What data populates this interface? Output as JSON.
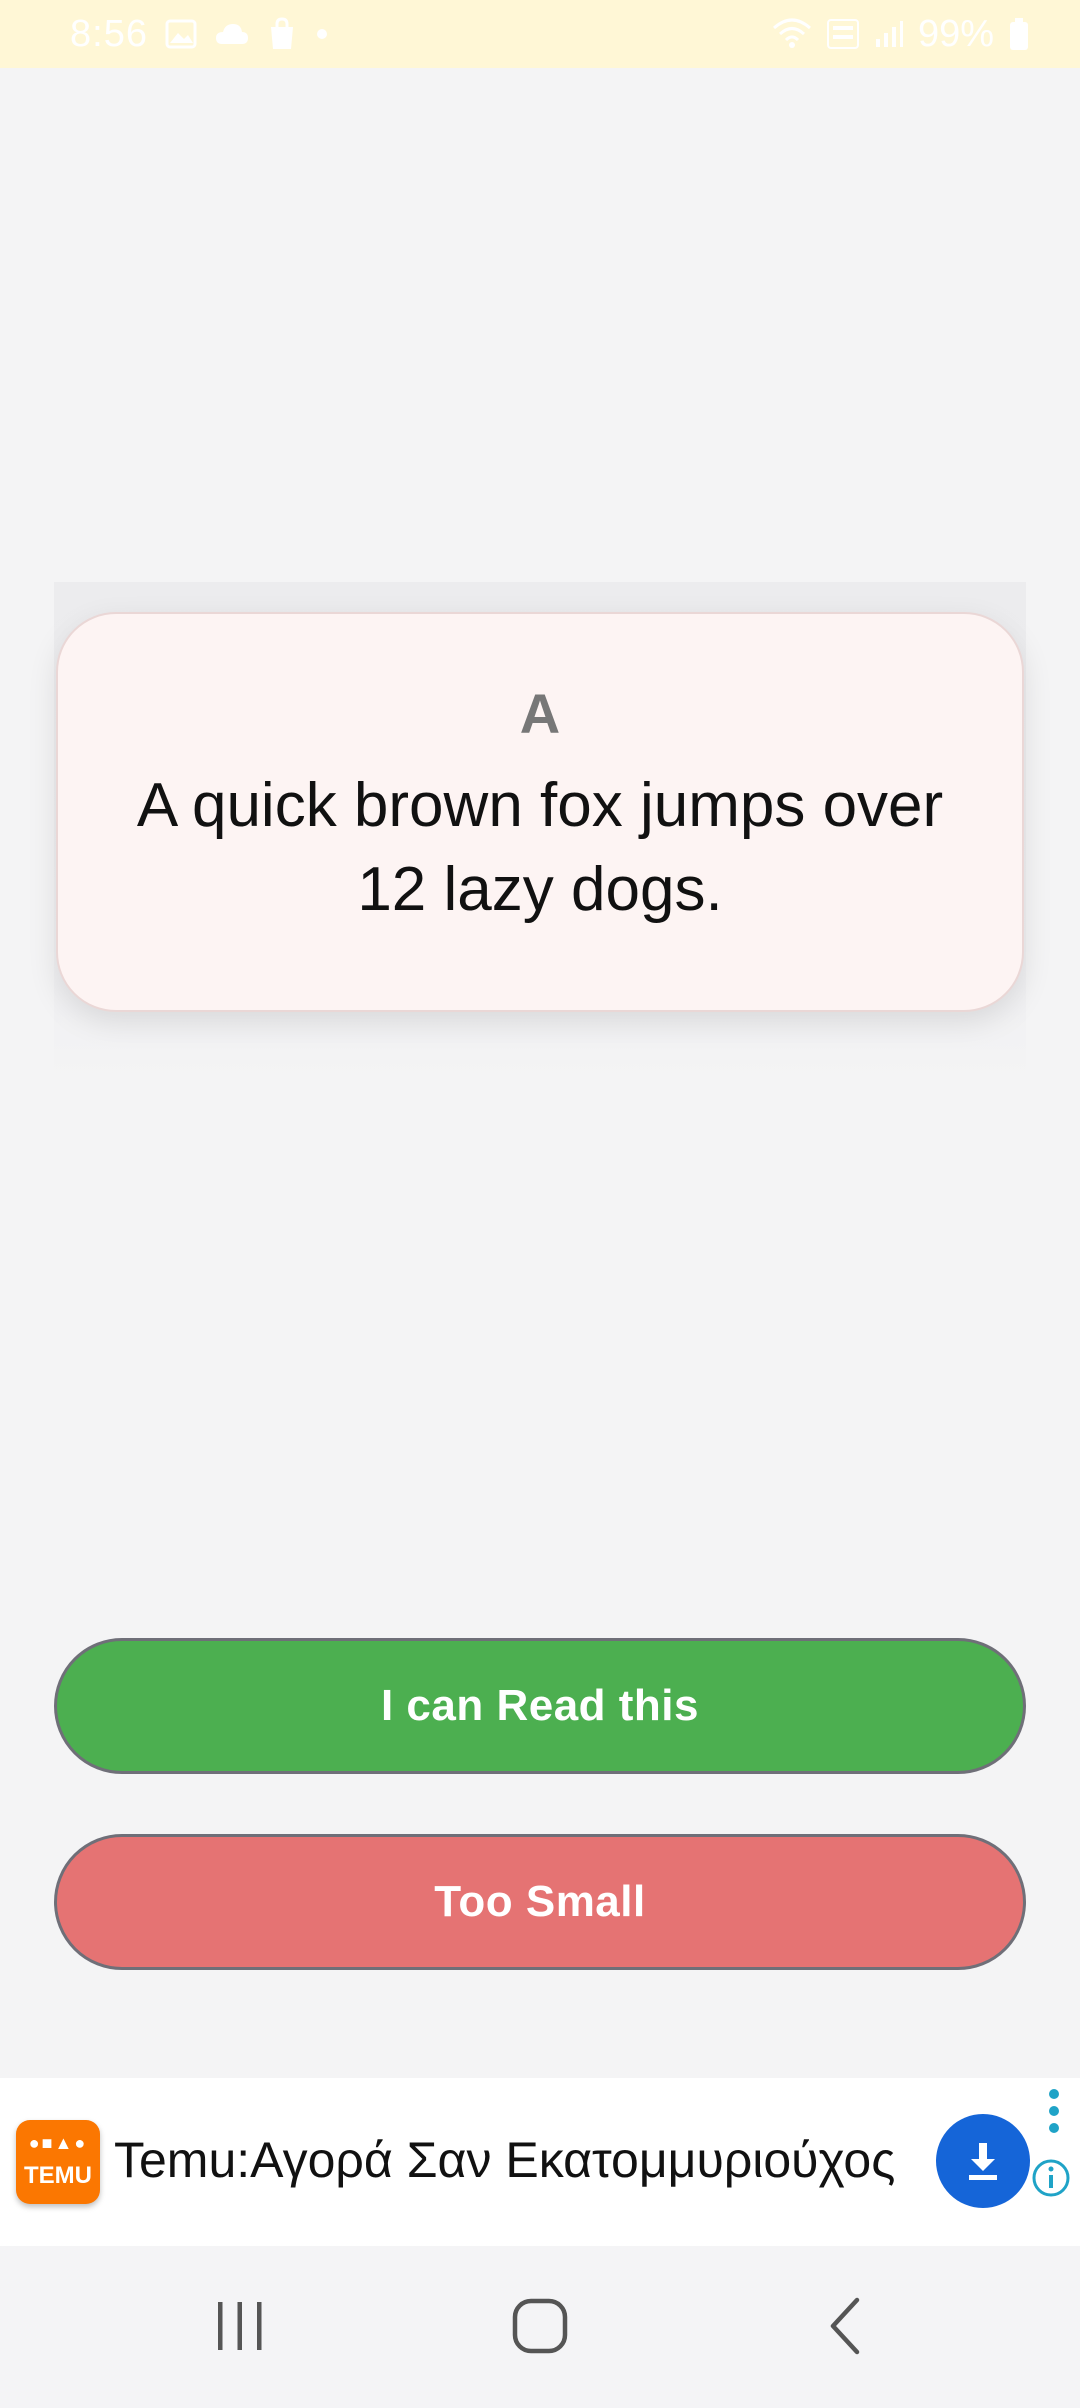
{
  "status_bar": {
    "time": "8:56",
    "battery": "99%",
    "left_icons": [
      "gallery-icon",
      "cloud-icon",
      "shopping-bag-icon",
      "dot-icon"
    ],
    "right_icons": [
      "wifi-icon",
      "volte-icon",
      "signal-icon",
      "battery-icon"
    ]
  },
  "card": {
    "label": "A",
    "text": "A quick brown fox jumps over 12 lazy dogs."
  },
  "buttons": {
    "read": "I can Read this",
    "too_small": "Too Small"
  },
  "ad": {
    "logo_text": "TEMU",
    "title": "Temu:Αγορά Σαν Εκατομμυριούχος",
    "icons": [
      "download-icon",
      "more-vert-icon",
      "info-icon"
    ]
  },
  "nav": {
    "icons": [
      "recents-icon",
      "home-icon",
      "back-icon"
    ]
  },
  "colors": {
    "status_bar_bg": "#fff7d6",
    "card_bg": "#fdf4f3",
    "read_button": "#4caf50",
    "too_small_button": "#e57373",
    "ad_download": "#1565d8",
    "temu_orange": "#fb7701"
  }
}
